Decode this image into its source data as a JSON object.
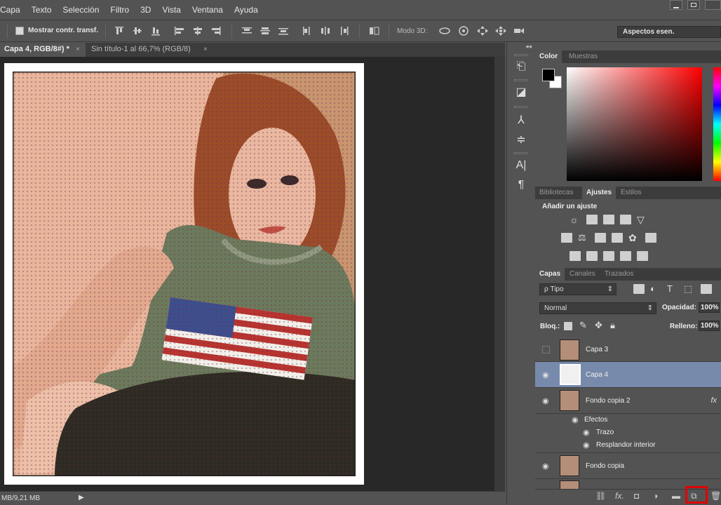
{
  "menu": [
    "Capa",
    "Texto",
    "Selección",
    "Filtro",
    "3D",
    "Vista",
    "Ventana",
    "Ayuda"
  ],
  "options": {
    "show_transform_label": "Mostrar contr. transf.",
    "mode3d_label": "Modo 3D:",
    "workspace": "Aspectos esen."
  },
  "tabs": [
    {
      "label": "Capa 4, RGB/8#) *",
      "close": "×"
    },
    {
      "label": "Sin título-1 al 66,7% (RGB/8)",
      "close": "×"
    }
  ],
  "status": {
    "doc_size": "MB/9,21 MB"
  },
  "color_panel": {
    "tabs": [
      "Color",
      "Muestras"
    ]
  },
  "adjust_panel": {
    "tabs": [
      "Bibliotecas",
      "Ajustes",
      "Estilos"
    ],
    "heading": "Añadir un ajuste"
  },
  "layers_panel": {
    "tabs": [
      "Capas",
      "Canales",
      "Trazados"
    ],
    "filter": "ρ Tipo",
    "blend_mode": "Normal",
    "opacity_label": "Opacidad:",
    "opacity_value": "100%",
    "lock_label": "Bloq.:",
    "fill_label": "Relleno:",
    "fill_value": "100%",
    "layers": [
      {
        "name": "Capa 3",
        "visible": false
      },
      {
        "name": "Capa 4",
        "visible": true,
        "selected": true
      },
      {
        "name": "Fondo copia 2",
        "visible": true,
        "fx": "fx"
      },
      {
        "name": "Efectos"
      },
      {
        "name": "Trazo"
      },
      {
        "name": "Resplandor interior"
      },
      {
        "name": "Fondo copia",
        "visible": true
      }
    ]
  },
  "colors": {
    "selected_layer": "#778aab",
    "highlight_box": "#e00000"
  }
}
